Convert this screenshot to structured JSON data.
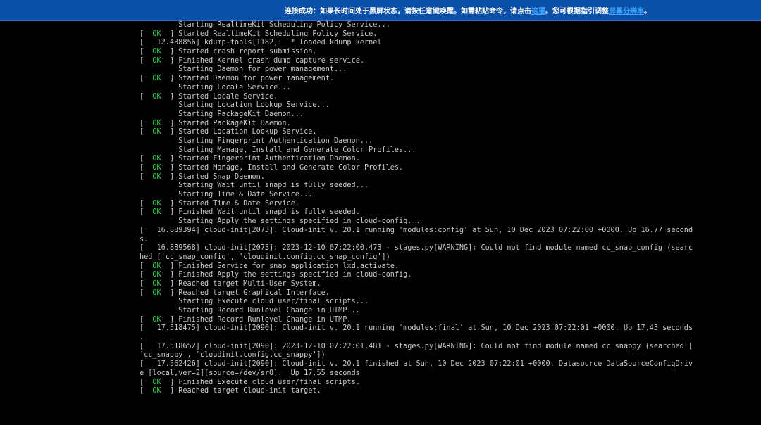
{
  "notice_bar": {
    "text_before": "连接成功：如果长时间处于黑屏状态，请按任意键唤醒。如需粘贴命令，请点击",
    "link1": "这里",
    "text_middle": "。您可根据指引调整",
    "link2": "屏幕分辨率",
    "text_after": "。"
  },
  "console": {
    "ok_label": "OK",
    "lines": [
      {
        "status": "",
        "text": "         Starting RealtimeKit Scheduling Policy Service..."
      },
      {
        "status": "ok",
        "text": " Started RealtimeKit Scheduling Policy Service."
      },
      {
        "status": "",
        "text": "[   12.438856] kdump-tools[1182]:  * loaded kdump kernel"
      },
      {
        "status": "ok",
        "text": " Started crash report submission."
      },
      {
        "status": "ok",
        "text": " Finished Kernel crash dump capture service."
      },
      {
        "status": "",
        "text": "         Starting Daemon for power management..."
      },
      {
        "status": "ok",
        "text": " Started Daemon for power management."
      },
      {
        "status": "",
        "text": "         Starting Locale Service..."
      },
      {
        "status": "ok",
        "text": " Started Locale Service."
      },
      {
        "status": "",
        "text": "         Starting Location Lookup Service..."
      },
      {
        "status": "",
        "text": "         Starting PackageKit Daemon..."
      },
      {
        "status": "ok",
        "text": " Started PackageKit Daemon."
      },
      {
        "status": "ok",
        "text": " Started Location Lookup Service."
      },
      {
        "status": "",
        "text": "         Starting Fingerprint Authentication Daemon..."
      },
      {
        "status": "",
        "text": "         Starting Manage, Install and Generate Color Profiles..."
      },
      {
        "status": "ok",
        "text": " Started Fingerprint Authentication Daemon."
      },
      {
        "status": "ok",
        "text": " Started Manage, Install and Generate Color Profiles."
      },
      {
        "status": "ok",
        "text": " Started Snap Daemon."
      },
      {
        "status": "",
        "text": "         Starting Wait until snapd is fully seeded..."
      },
      {
        "status": "",
        "text": "         Starting Time & Date Service..."
      },
      {
        "status": "ok",
        "text": " Started Time & Date Service."
      },
      {
        "status": "ok",
        "text": " Finished Wait until snapd is fully seeded."
      },
      {
        "status": "",
        "text": "         Starting Apply the settings specified in cloud-config..."
      },
      {
        "status": "",
        "text": "[   16.889394] cloud-init[2073]: Cloud-init v. 20.1 running 'modules:config' at Sun, 10 Dec 2023 07:22:00 +0000. Up 16.77 second"
      },
      {
        "status": "",
        "text": "s."
      },
      {
        "status": "",
        "text": "[   16.889568] cloud-init[2073]: 2023-12-10 07:22:00,473 - stages.py[WARNING]: Could not find module named cc_snap_config (searc"
      },
      {
        "status": "",
        "text": "hed ['cc_snap_config', 'cloudinit.config.cc_snap_config'])"
      },
      {
        "status": "ok",
        "text": " Finished Service for snap application lxd.activate."
      },
      {
        "status": "ok",
        "text": " Finished Apply the settings specified in cloud-config."
      },
      {
        "status": "ok",
        "text": " Reached target Multi-User System."
      },
      {
        "status": "ok",
        "text": " Reached target Graphical Interface."
      },
      {
        "status": "",
        "text": "         Starting Execute cloud user/final scripts..."
      },
      {
        "status": "",
        "text": "         Starting Record Runlevel Change in UTMP..."
      },
      {
        "status": "ok",
        "text": " Finished Record Runlevel Change in UTMP."
      },
      {
        "status": "",
        "text": "[   17.518475] cloud-init[2090]: Cloud-init v. 20.1 running 'modules:final' at Sun, 10 Dec 2023 07:22:01 +0000. Up 17.43 seconds"
      },
      {
        "status": "",
        "text": "."
      },
      {
        "status": "",
        "text": "[   17.518652] cloud-init[2090]: 2023-12-10 07:22:01,481 - stages.py[WARNING]: Could not find module named cc_snappy (searched ["
      },
      {
        "status": "",
        "text": "'cc_snappy', 'cloudinit.config.cc_snappy'])"
      },
      {
        "status": "",
        "text": "[   17.562426] cloud-init[2090]: Cloud-init v. 20.1 finished at Sun, 10 Dec 2023 07:22:01 +0000. Datasource DataSourceConfigDriv"
      },
      {
        "status": "",
        "text": "e [local,ver=2][source=/dev/sr0].  Up 17.55 seconds"
      },
      {
        "status": "ok",
        "text": " Finished Execute cloud user/final scripts."
      },
      {
        "status": "ok",
        "text": " Reached target Cloud-init target."
      }
    ]
  }
}
